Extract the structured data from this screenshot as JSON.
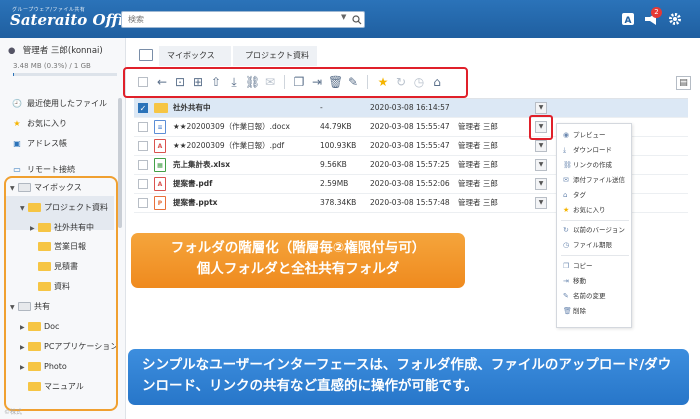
{
  "app": {
    "logo_sub": "グループウェア/ファイル共有",
    "logo_main": "Sateraito Office"
  },
  "header": {
    "search_placeholder": "検索",
    "notification_count": "2"
  },
  "sidebar": {
    "user": "管理者 三郎(konnai)",
    "usage_text": "3.48 MB (0.3%) / 1 GB",
    "usage_fraction": 0.003,
    "items": [
      {
        "label": "最近使用したファイル"
      },
      {
        "label": "お気に入り"
      },
      {
        "label": "アドレス帳"
      },
      {
        "label": "リモート接続"
      }
    ],
    "tree": [
      {
        "label": "マイボックス"
      },
      {
        "label": "プロジェクト資料"
      },
      {
        "label": "社外共有中"
      },
      {
        "label": "営業日報"
      },
      {
        "label": "見積書"
      },
      {
        "label": "資料"
      },
      {
        "label": "共有"
      },
      {
        "label": "Doc"
      },
      {
        "label": "PCアプリケーション"
      },
      {
        "label": "Photo"
      },
      {
        "label": "マニュアル"
      }
    ],
    "footer": "©株式"
  },
  "breadcrumb": [
    "マイボックス",
    "プロジェクト資料"
  ],
  "files": [
    {
      "name": "社外共有中",
      "size": "-",
      "date": "2020-03-08 16:14:57",
      "owner": "",
      "type": "folder"
    },
    {
      "name": "★★20200309（作業日報）.docx",
      "size": "44.79KB",
      "date": "2020-03-08 15:55:47",
      "owner": "管理者 三郎",
      "type": "doc"
    },
    {
      "name": "★★20200309（作業日報）.pdf",
      "size": "100.93KB",
      "date": "2020-03-08 15:55:47",
      "owner": "管理者 三郎",
      "type": "pdf"
    },
    {
      "name": "売上集計表.xlsx",
      "size": "9.56KB",
      "date": "2020-03-08 15:57:25",
      "owner": "管理者 三郎",
      "type": "xls"
    },
    {
      "name": "提案書.pdf",
      "size": "2.59MB",
      "date": "2020-03-08 15:52:06",
      "owner": "管理者 三郎",
      "type": "pdf"
    },
    {
      "name": "提案書.pptx",
      "size": "378.34KB",
      "date": "2020-03-08 15:57:48",
      "owner": "管理者 三郎",
      "type": "ppt"
    }
  ],
  "menu": [
    "プレビュー",
    "ダウンロード",
    "リンクの作成",
    "添付ファイル送信",
    "タグ",
    "お気に入り",
    "以前のバージョン",
    "ファイル期限",
    "コピー",
    "移動",
    "名前の変更",
    "削除"
  ],
  "callouts": {
    "folder_line1": "フォルダの階層化（階層毎②権限付与可）",
    "folder_line2": "個人フォルダと全社共有フォルダ",
    "ui_text": "シンプルなユーザーインターフェースは、フォルダ作成、ファイルのアップロード/ダウンロード、リンクの共有など直感的に操作が可能です。"
  },
  "colors": {
    "header": "#2b73b9",
    "toolbar_highlight": "#e0202a",
    "callout_orange": "#ef8a1e",
    "callout_blue": "#2776c9"
  }
}
